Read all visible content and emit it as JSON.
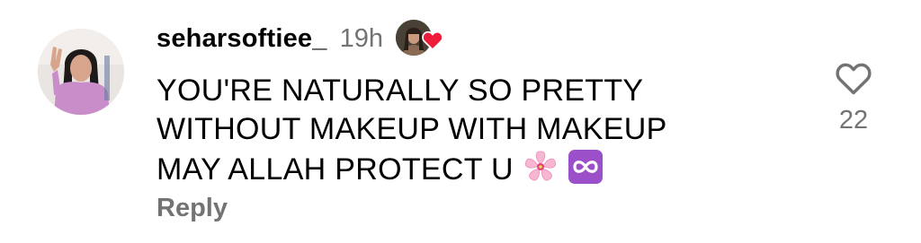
{
  "comment": {
    "username": "seharsoftiee_",
    "timestamp": "19h",
    "text_lines": [
      "YOU'RE NATURALLY SO PRETTY",
      "WITHOUT MAKEUP  WITH MAKEUP",
      "MAY ALLAH PROTECT U"
    ],
    "emojis": [
      "cherry-blossom-icon",
      "infinity-icon"
    ],
    "reply_label": "Reply",
    "like_count": "22",
    "liked_by_author": true
  },
  "colors": {
    "text_primary": "#000000",
    "text_secondary": "#737373",
    "heart_red": "#ed1c3b",
    "infinity_purple": "#9b4fc9",
    "blossom_pink": "#f7b6d2"
  }
}
